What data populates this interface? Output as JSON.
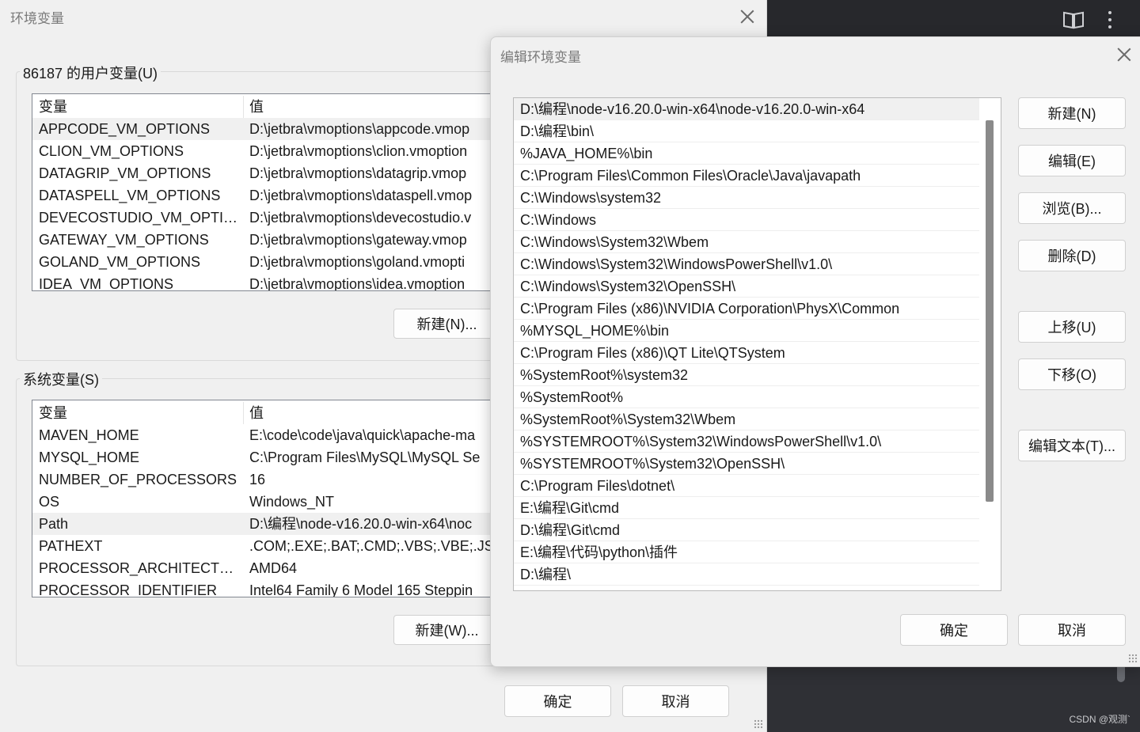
{
  "env_dialog": {
    "title": "环境变量",
    "user_vars": {
      "group_label": "86187 的用户变量(U)",
      "headers": {
        "name": "变量",
        "value": "值"
      },
      "rows": [
        {
          "name": "APPCODE_VM_OPTIONS",
          "value": "D:\\jetbra\\vmoptions\\appcode.vmop"
        },
        {
          "name": "CLION_VM_OPTIONS",
          "value": "D:\\jetbra\\vmoptions\\clion.vmoption"
        },
        {
          "name": "DATAGRIP_VM_OPTIONS",
          "value": "D:\\jetbra\\vmoptions\\datagrip.vmop"
        },
        {
          "name": "DATASPELL_VM_OPTIONS",
          "value": "D:\\jetbra\\vmoptions\\dataspell.vmop"
        },
        {
          "name": "DEVECOSTUDIO_VM_OPTIO...",
          "value": "D:\\jetbra\\vmoptions\\devecostudio.v"
        },
        {
          "name": "GATEWAY_VM_OPTIONS",
          "value": "D:\\jetbra\\vmoptions\\gateway.vmop"
        },
        {
          "name": "GOLAND_VM_OPTIONS",
          "value": "D:\\jetbra\\vmoptions\\goland.vmopti"
        },
        {
          "name": "IDEA_VM_OPTIONS",
          "value": "D:\\jetbra\\vmoptions\\idea.vmoption"
        }
      ],
      "new_button": "新建(N)..."
    },
    "system_vars": {
      "group_label": "系统变量(S)",
      "headers": {
        "name": "变量",
        "value": "值"
      },
      "rows": [
        {
          "name": "MAVEN_HOME",
          "value": "E:\\code\\code\\java\\quick\\apache-ma"
        },
        {
          "name": "MYSQL_HOME",
          "value": "C:\\Program Files\\MySQL\\MySQL Se"
        },
        {
          "name": "NUMBER_OF_PROCESSORS",
          "value": "16"
        },
        {
          "name": "OS",
          "value": "Windows_NT"
        },
        {
          "name": "Path",
          "value": "D:\\编程\\node-v16.20.0-win-x64\\noc"
        },
        {
          "name": "PATHEXT",
          "value": ".COM;.EXE;.BAT;.CMD;.VBS;.VBE;.JS;.J"
        },
        {
          "name": "PROCESSOR_ARCHITECTURE",
          "value": "AMD64"
        },
        {
          "name": "PROCESSOR_IDENTIFIER",
          "value": "Intel64 Family 6 Model 165 Steppin"
        }
      ],
      "new_button": "新建(W)..."
    },
    "ok_button": "确定",
    "cancel_button": "取消"
  },
  "edit_dialog": {
    "title": "编辑环境变量",
    "paths": [
      "D:\\编程\\node-v16.20.0-win-x64\\node-v16.20.0-win-x64",
      "D:\\编程\\bin\\",
      "%JAVA_HOME%\\bin",
      "C:\\Program Files\\Common Files\\Oracle\\Java\\javapath",
      "C:\\Windows\\system32",
      "C:\\Windows",
      "C:\\Windows\\System32\\Wbem",
      "C:\\Windows\\System32\\WindowsPowerShell\\v1.0\\",
      "C:\\Windows\\System32\\OpenSSH\\",
      "C:\\Program Files (x86)\\NVIDIA Corporation\\PhysX\\Common",
      "%MYSQL_HOME%\\bin",
      "C:\\Program Files (x86)\\QT Lite\\QTSystem",
      "%SystemRoot%\\system32",
      "%SystemRoot%",
      "%SystemRoot%\\System32\\Wbem",
      "%SYSTEMROOT%\\System32\\WindowsPowerShell\\v1.0\\",
      "%SYSTEMROOT%\\System32\\OpenSSH\\",
      "C:\\Program Files\\dotnet\\",
      "E:\\编程\\Git\\cmd",
      "D:\\编程\\Git\\cmd",
      "E:\\编程\\代码\\python\\插件",
      "D:\\编程\\"
    ],
    "buttons": {
      "new": "新建(N)",
      "edit": "编辑(E)",
      "browse": "浏览(B)...",
      "delete": "删除(D)",
      "move_up": "上移(U)",
      "move_down": "下移(O)",
      "edit_text": "编辑文本(T)...",
      "ok": "确定",
      "cancel": "取消"
    }
  },
  "background_app": {
    "watermark": "CSDN @观测`"
  }
}
